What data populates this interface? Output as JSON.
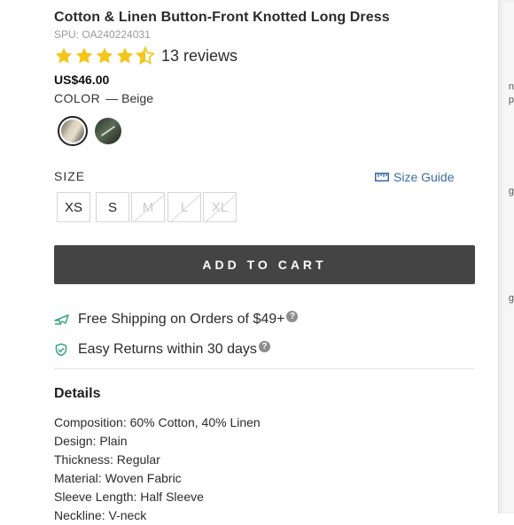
{
  "product": {
    "title": "Cotton & Linen Button-Front Knotted Long Dress",
    "spu": "SPU: OA240224031",
    "rating": 4.5,
    "reviews": "13 reviews",
    "price": "US$46.00",
    "color_label": "COLOR",
    "color_value": "— Beige",
    "swatches": [
      "Beige",
      "Green"
    ]
  },
  "size": {
    "label": "SIZE",
    "guide": "Size Guide",
    "options": [
      {
        "label": "XS",
        "available": true
      },
      {
        "label": "S",
        "available": true
      },
      {
        "label": "M",
        "available": false
      },
      {
        "label": "L",
        "available": false
      },
      {
        "label": "XL",
        "available": false
      }
    ]
  },
  "cart": {
    "add_label": "ADD TO CART"
  },
  "perks": {
    "shipping": "Free Shipping on Orders of $49+",
    "returns": "Easy Returns within 30 days",
    "help_glyph": "?"
  },
  "details": {
    "title": "Details",
    "items": [
      "Composition: 60% Cotton, 40% Linen",
      "Design: Plain",
      "Thickness: Regular",
      "Material: Woven Fabric",
      "Sleeve Length: Half Sleeve",
      "Neckline: V-neck"
    ]
  },
  "colors": {
    "star": "#f5c518",
    "link": "#3b6aa0",
    "button": "#444444",
    "perk_icon": "#3aa57a"
  },
  "edge_glyphs": [
    "n",
    "p",
    "g",
    "g"
  ]
}
